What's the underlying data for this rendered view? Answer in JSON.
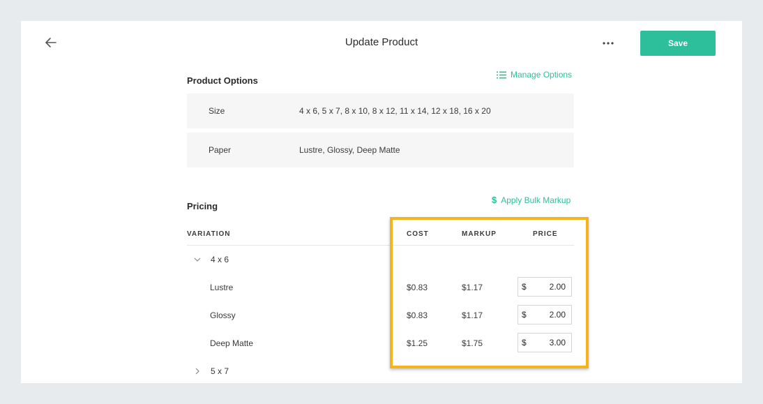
{
  "header": {
    "title": "Update Product",
    "save_label": "Save"
  },
  "product_options": {
    "title": "Product Options",
    "manage_label": "Manage Options",
    "options": [
      {
        "name": "Size",
        "values": "4 x 6, 5 x 7, 8 x 10, 8 x 12, 11 x 14, 12 x 18, 16 x 20"
      },
      {
        "name": "Paper",
        "values": "Lustre, Glossy, Deep Matte"
      }
    ]
  },
  "pricing": {
    "title": "Pricing",
    "bulk_markup_label": "Apply Bulk Markup",
    "columns": {
      "variation": "VARIATION",
      "cost": "COST",
      "markup": "MARKUP",
      "price": "PRICE"
    },
    "currency_symbol": "$",
    "groups": [
      {
        "label": "4 x 6",
        "expanded": true,
        "rows": [
          {
            "name": "Lustre",
            "cost": "$0.83",
            "markup": "$1.17",
            "price": "2.00"
          },
          {
            "name": "Glossy",
            "cost": "$0.83",
            "markup": "$1.17",
            "price": "2.00"
          },
          {
            "name": "Deep Matte",
            "cost": "$1.25",
            "markup": "$1.75",
            "price": "3.00"
          }
        ]
      },
      {
        "label": "5 x 7",
        "expanded": false
      }
    ]
  },
  "colors": {
    "accent": "#2dbe9b",
    "highlight": "#f5b41e",
    "background": "#e8ebee"
  }
}
